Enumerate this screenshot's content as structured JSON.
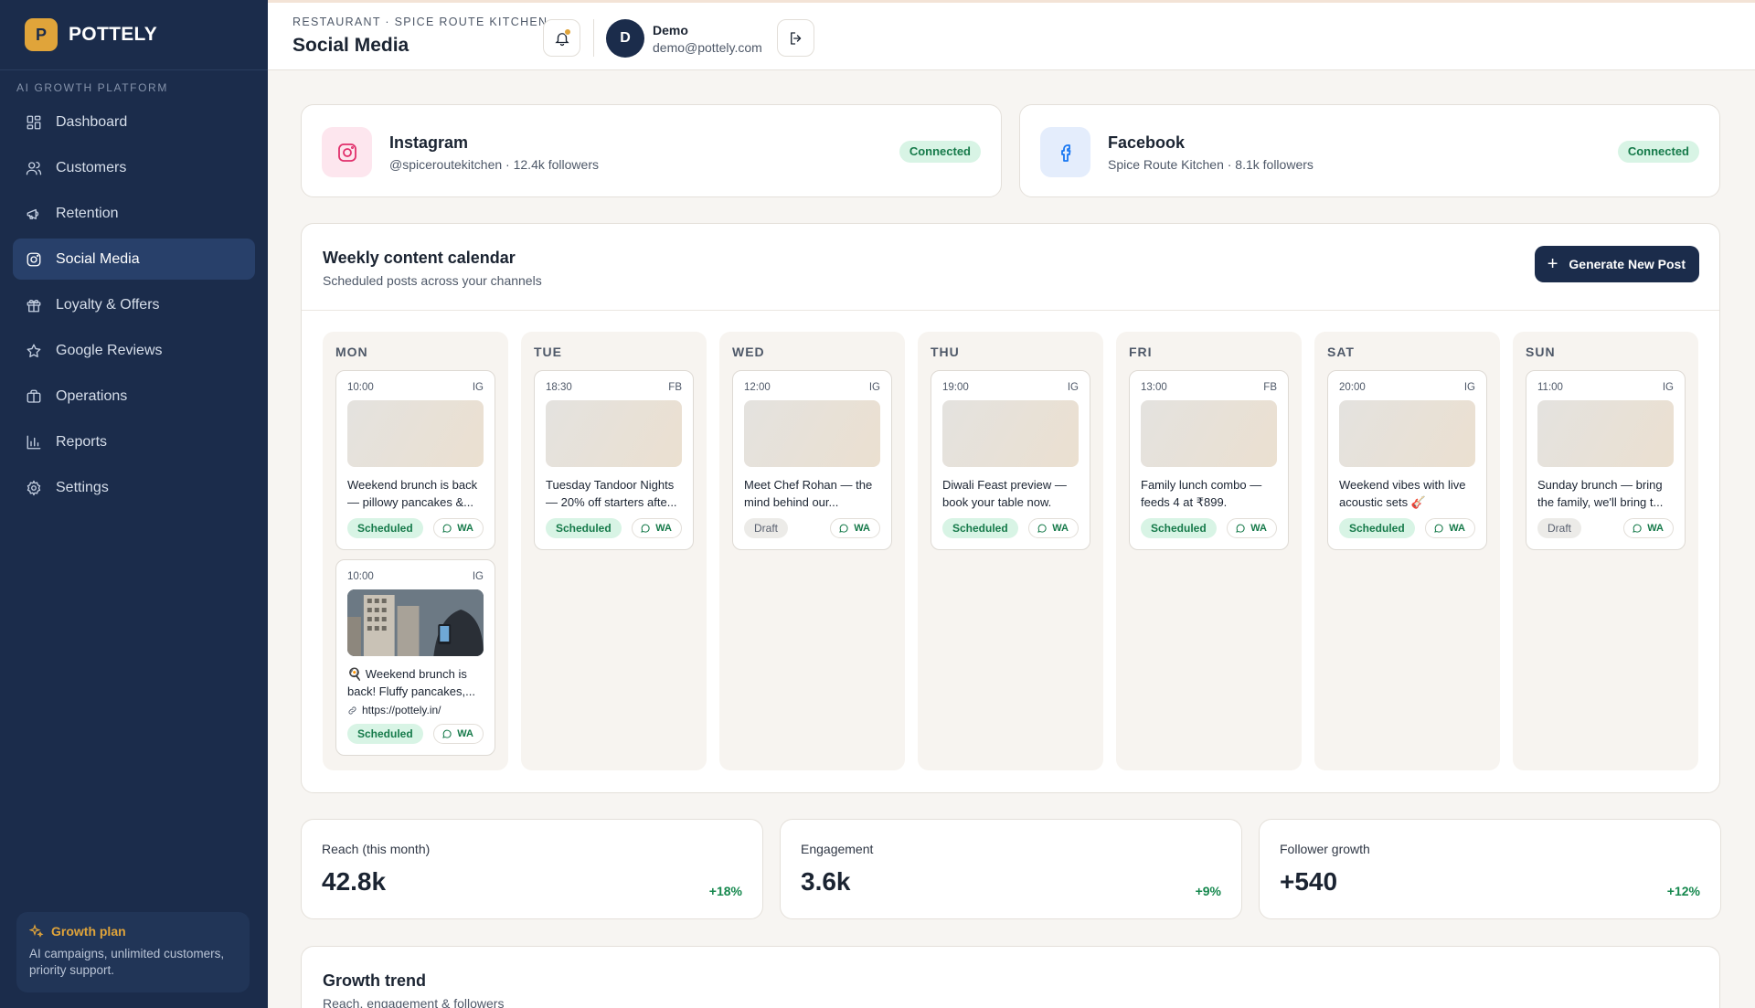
{
  "brand": {
    "logo_letter": "P",
    "name": "POTTELY",
    "tagline": "AI GROWTH PLATFORM"
  },
  "sidebar": {
    "items": [
      {
        "label": "Dashboard",
        "icon": "grid-icon"
      },
      {
        "label": "Customers",
        "icon": "users-icon"
      },
      {
        "label": "Retention",
        "icon": "megaphone-icon"
      },
      {
        "label": "Social Media",
        "icon": "instagram-icon",
        "active": true
      },
      {
        "label": "Loyalty & Offers",
        "icon": "gift-icon"
      },
      {
        "label": "Google Reviews",
        "icon": "star-icon"
      },
      {
        "label": "Operations",
        "icon": "briefcase-icon"
      },
      {
        "label": "Reports",
        "icon": "bar-chart-icon"
      },
      {
        "label": "Settings",
        "icon": "gear-icon"
      }
    ],
    "plan": {
      "title": "Growth plan",
      "description": "AI campaigns, unlimited customers, priority support."
    }
  },
  "header": {
    "breadcrumb": "RESTAURANT · SPICE ROUTE KITCHEN",
    "title": "Social Media",
    "user": {
      "initial": "D",
      "name": "Demo",
      "email": "demo@pottely.com"
    }
  },
  "channels": [
    {
      "name": "Instagram",
      "meta": "@spiceroutekitchen · 12.4k followers",
      "status": "Connected",
      "color": "#e1306c"
    },
    {
      "name": "Facebook",
      "meta": "Spice Route Kitchen · 8.1k followers",
      "status": "Connected",
      "color": "#1877f2"
    }
  ],
  "calendar": {
    "title": "Weekly content calendar",
    "subtitle": "Scheduled posts across your channels",
    "button_label": "Generate New Post",
    "days": [
      {
        "name": "MON",
        "posts": [
          {
            "time": "10:00",
            "channel": "IG",
            "text": "Weekend brunch is back — pillowy pancakes &...",
            "status": "Scheduled",
            "share": "WA"
          },
          {
            "time": "10:00",
            "channel": "IG",
            "text": "🍳 Weekend brunch is back! Fluffy pancakes,...",
            "link": "https://pottely.in/",
            "status": "Scheduled",
            "share": "WA"
          }
        ]
      },
      {
        "name": "TUE",
        "posts": [
          {
            "time": "18:30",
            "channel": "FB",
            "text": "Tuesday Tandoor Nights — 20% off starters afte...",
            "status": "Scheduled",
            "share": "WA"
          }
        ]
      },
      {
        "name": "WED",
        "posts": [
          {
            "time": "12:00",
            "channel": "IG",
            "text": "Meet Chef Rohan — the mind behind our...",
            "status": "Draft",
            "share": "WA"
          }
        ]
      },
      {
        "name": "THU",
        "posts": [
          {
            "time": "19:00",
            "channel": "IG",
            "text": "Diwali Feast preview — book your table now.",
            "status": "Scheduled",
            "share": "WA"
          }
        ]
      },
      {
        "name": "FRI",
        "posts": [
          {
            "time": "13:00",
            "channel": "FB",
            "text": "Family lunch combo — feeds 4 at ₹899.",
            "status": "Scheduled",
            "share": "WA"
          }
        ]
      },
      {
        "name": "SAT",
        "posts": [
          {
            "time": "20:00",
            "channel": "IG",
            "text": "Weekend vibes with live acoustic sets 🎸",
            "status": "Scheduled",
            "share": "WA"
          }
        ]
      },
      {
        "name": "SUN",
        "posts": [
          {
            "time": "11:00",
            "channel": "IG",
            "text": "Sunday brunch — bring the family, we'll bring t...",
            "status": "Draft",
            "share": "WA"
          }
        ]
      }
    ]
  },
  "metrics": [
    {
      "label": "Reach (this month)",
      "value": "42.8k",
      "delta": "+18%"
    },
    {
      "label": "Engagement",
      "value": "3.6k",
      "delta": "+9%"
    },
    {
      "label": "Follower growth",
      "value": "+540",
      "delta": "+12%"
    }
  ],
  "growth": {
    "title": "Growth trend",
    "subtitle": "Reach, engagement & followers"
  },
  "colors": {
    "sidebar": "#1b2c4b",
    "accent": "#e0a43a",
    "success": "#167a4a"
  }
}
